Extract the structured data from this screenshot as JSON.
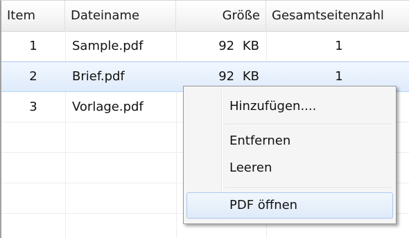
{
  "table": {
    "columns": [
      "Item",
      "Dateiname",
      "Größe",
      "Gesamtseitenzahl"
    ],
    "rows": [
      {
        "item": "1",
        "name": "Sample.pdf",
        "size": "92 KB",
        "pages": "1"
      },
      {
        "item": "2",
        "name": "Brief.pdf",
        "size": "92 KB",
        "pages": "1"
      },
      {
        "item": "3",
        "name": "Vorlage.pdf",
        "size": "",
        "pages": ""
      }
    ],
    "selected_row": 2
  },
  "context_menu": {
    "items": [
      "Hinzufügen....",
      "Entfernen",
      "Leeren",
      "PDF öffnen"
    ],
    "hovered": "PDF öffnen"
  },
  "colors": {
    "selection": "#dfebfb",
    "menu_hover_border": "#a9c8ee"
  }
}
